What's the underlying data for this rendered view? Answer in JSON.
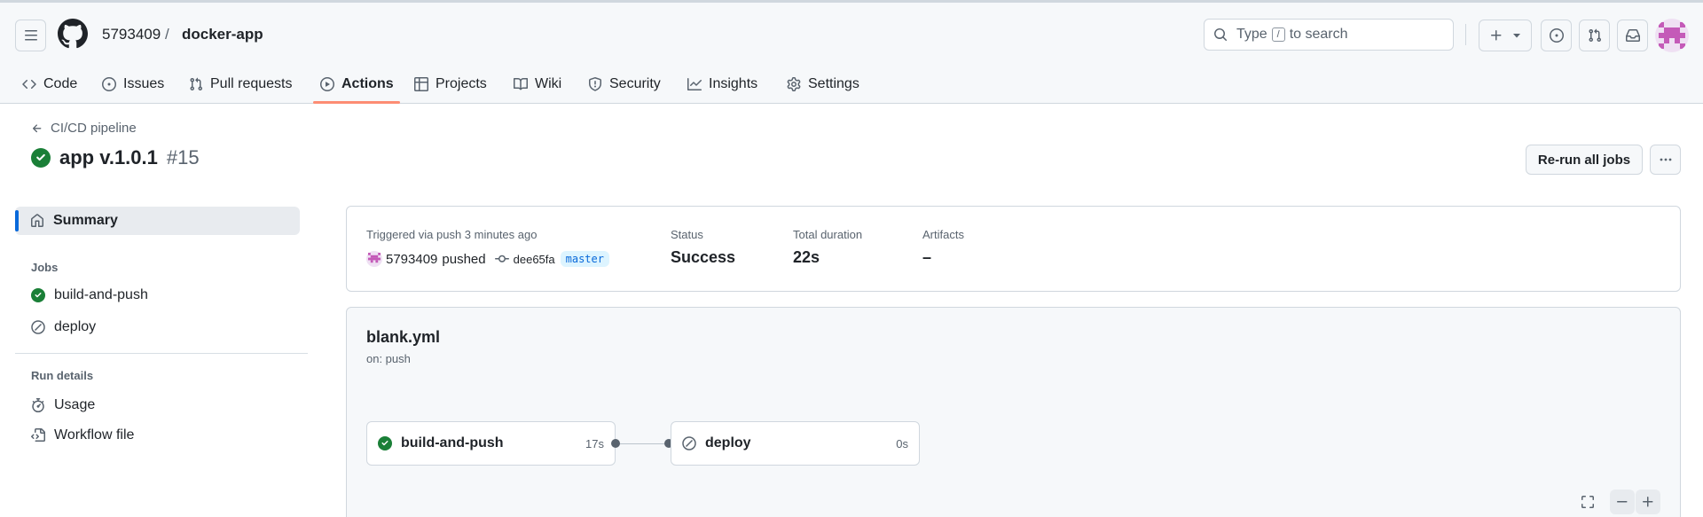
{
  "header": {
    "owner": "5793409",
    "separator": "/",
    "repo": "docker-app",
    "search_prefix": "Type",
    "search_key": "/",
    "search_suffix": "to search"
  },
  "tabs": [
    {
      "label": "Code",
      "icon": "code-icon"
    },
    {
      "label": "Issues",
      "icon": "issue-opened-icon"
    },
    {
      "label": "Pull requests",
      "icon": "git-pull-request-icon"
    },
    {
      "label": "Actions",
      "icon": "play-icon",
      "active": true
    },
    {
      "label": "Projects",
      "icon": "table-icon"
    },
    {
      "label": "Wiki",
      "icon": "book-icon"
    },
    {
      "label": "Security",
      "icon": "shield-icon"
    },
    {
      "label": "Insights",
      "icon": "graph-icon"
    },
    {
      "label": "Settings",
      "icon": "gear-icon"
    }
  ],
  "run": {
    "back_label": "CI/CD pipeline",
    "title": "app v.1.0.1",
    "number": "#15",
    "rerun_label": "Re-run all jobs"
  },
  "sidebar": {
    "summary_label": "Summary",
    "jobs_heading": "Jobs",
    "jobs": [
      {
        "label": "build-and-push",
        "status": "success"
      },
      {
        "label": "deploy",
        "status": "skipped"
      }
    ],
    "details_heading": "Run details",
    "details": [
      {
        "label": "Usage",
        "icon": "stopwatch-icon"
      },
      {
        "label": "Workflow file",
        "icon": "file-code-icon"
      }
    ]
  },
  "summary": {
    "trigger_label": "Triggered via push 3 minutes ago",
    "actor": "5793409",
    "action": "pushed",
    "commit": "dee65fa",
    "branch": "master",
    "status_label": "Status",
    "status_value": "Success",
    "duration_label": "Total duration",
    "duration_value": "22s",
    "artifacts_label": "Artifacts",
    "artifacts_value": "–"
  },
  "workflow": {
    "file": "blank.yml",
    "trigger": "on: push",
    "jobs": [
      {
        "name": "build-and-push",
        "duration": "17s",
        "status": "success"
      },
      {
        "name": "deploy",
        "duration": "0s",
        "status": "skipped"
      }
    ]
  },
  "colors": {
    "success": "#1a7f37",
    "accent": "#0969da",
    "tab_underline": "#fd8c73"
  }
}
